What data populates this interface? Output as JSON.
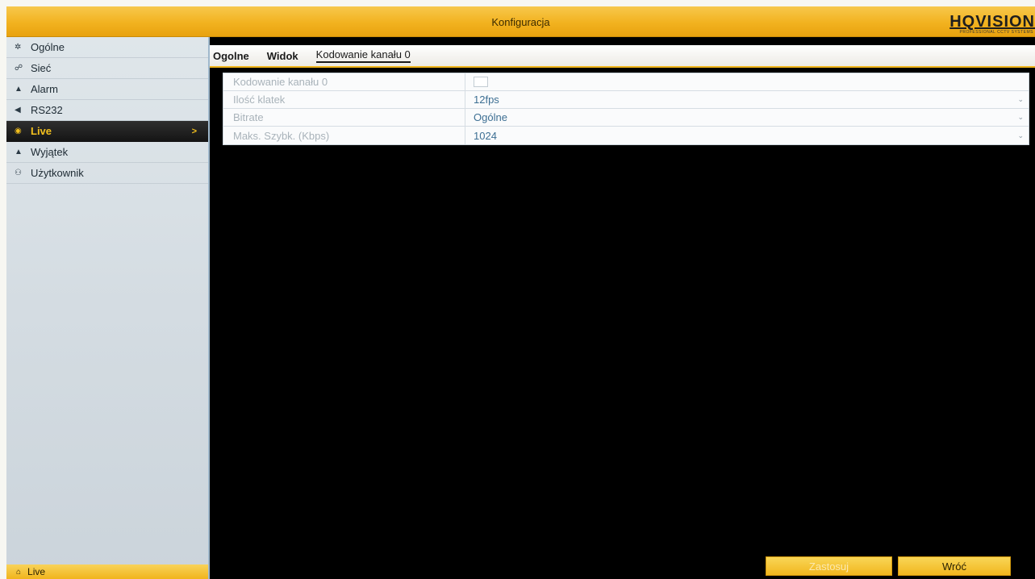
{
  "header": {
    "title": "Konfiguracja",
    "brand": "HQVISION",
    "brand_sub": "PROFESSIONAL CCTV SYSTEMS"
  },
  "sidebar": {
    "items": [
      {
        "label": "Ogólne",
        "icon": "gear-icon"
      },
      {
        "label": "Sieć",
        "icon": "network-icon"
      },
      {
        "label": "Alarm",
        "icon": "bell-icon"
      },
      {
        "label": "RS232",
        "icon": "serial-icon"
      },
      {
        "label": "Live",
        "icon": "eye-icon",
        "active": true,
        "arrow": ">"
      },
      {
        "label": "Wyjątek",
        "icon": "warning-icon"
      },
      {
        "label": "Użytkownik",
        "icon": "users-icon"
      }
    ],
    "bottom_label": "Live"
  },
  "tabs": [
    {
      "label": "Ogolne"
    },
    {
      "label": "Widok"
    },
    {
      "label": "Kodowanie kanału 0",
      "active": true
    }
  ],
  "settings": {
    "rows": [
      {
        "label": "Kodowanie kanału 0",
        "value": "",
        "type": "checkbox"
      },
      {
        "label": "Ilość klatek",
        "value": "12fps",
        "type": "select"
      },
      {
        "label": "Bitrate",
        "value": "Ogólne",
        "type": "select"
      },
      {
        "label": "Maks. Szybk. (Kbps)",
        "value": "1024",
        "type": "select"
      }
    ]
  },
  "buttons": {
    "save": "Zastosuj",
    "back": "Wróć"
  },
  "colors": {
    "accent": "#f2b21f",
    "active_text": "#f3c01e",
    "value_text": "#3d6f93"
  }
}
